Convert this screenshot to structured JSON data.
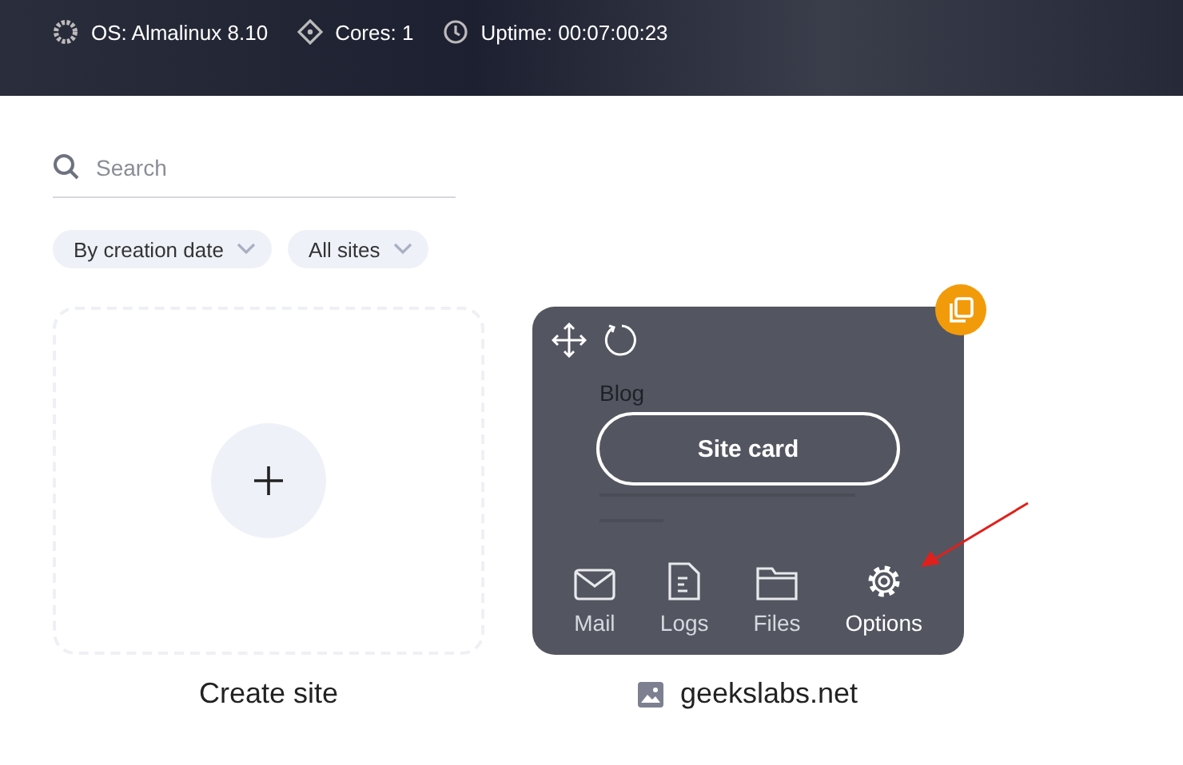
{
  "header": {
    "items": [
      {
        "kind": "os",
        "text": "OS: Almalinux 8.10"
      },
      {
        "kind": "cores",
        "text": "Cores: 1"
      },
      {
        "kind": "uptime",
        "text": "Uptime: 00:07:00:23"
      }
    ]
  },
  "search": {
    "placeholder": "Search"
  },
  "filters": [
    {
      "label": "By creation date"
    },
    {
      "label": "All sites"
    }
  ],
  "create_card": {
    "label": "Create site"
  },
  "site_card": {
    "preview_title": "Blog",
    "button": "Site card",
    "actions": [
      {
        "kind": "mail",
        "label": "Mail",
        "selected": false
      },
      {
        "kind": "logs",
        "label": "Logs",
        "selected": false
      },
      {
        "kind": "files",
        "label": "Files",
        "selected": false
      },
      {
        "kind": "options",
        "label": "Options",
        "selected": true
      }
    ],
    "name": "geekslabs.net"
  }
}
